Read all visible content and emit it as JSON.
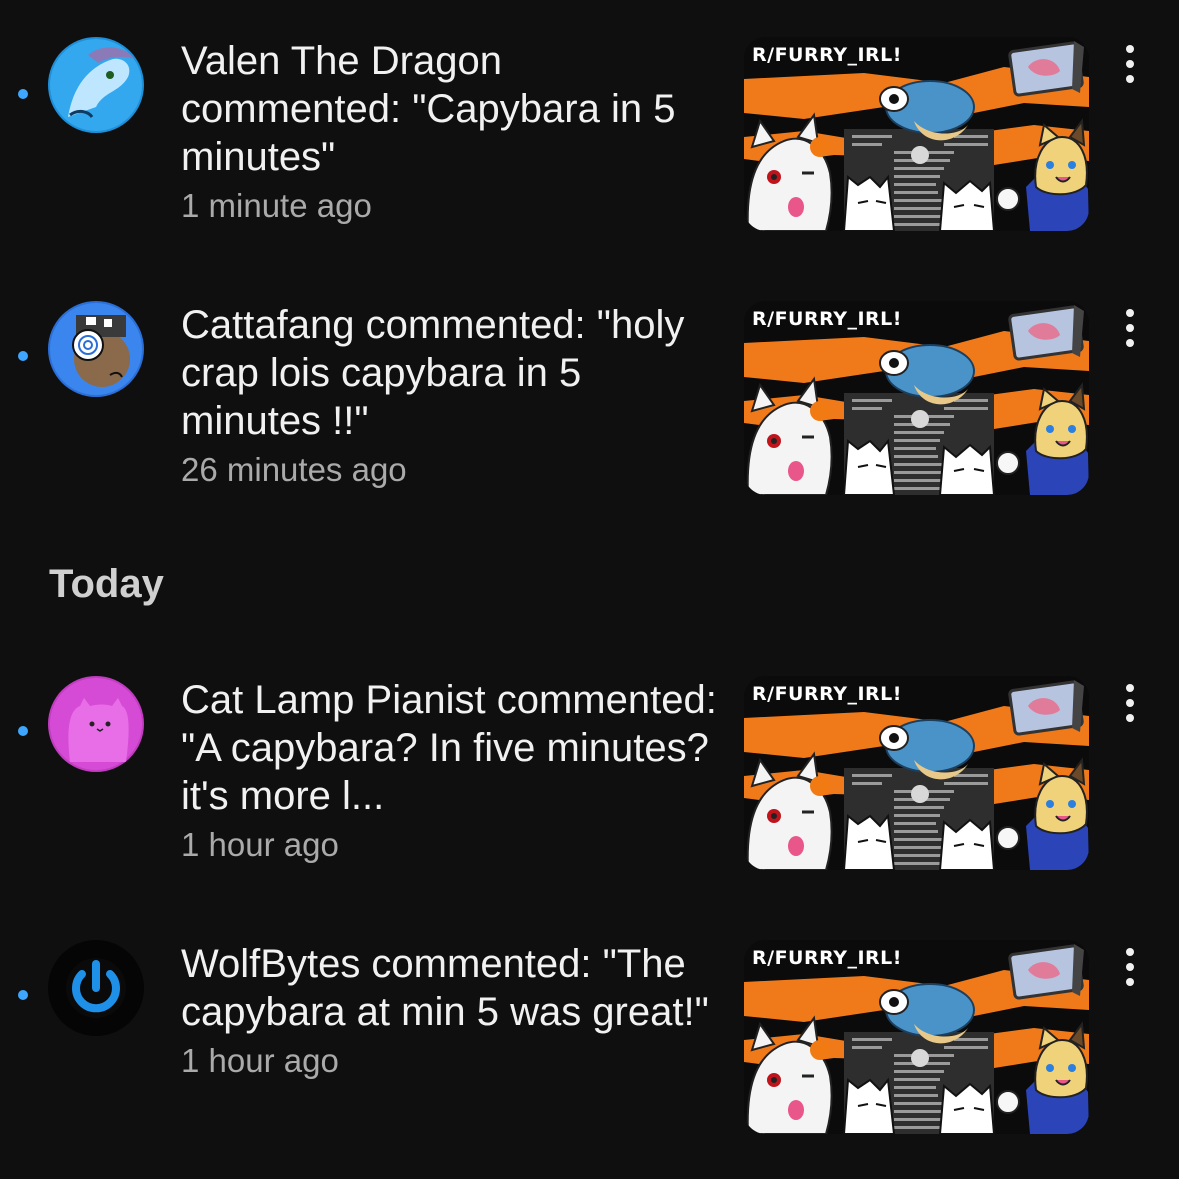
{
  "section_header": "Today",
  "notifications": [
    {
      "user": "Valen The Dragon",
      "message": "Valen The Dragon commented: \"Capybara in 5 minutes\"",
      "time": "1 minute ago",
      "thumbnail_title": "R/FURRY_IRL!",
      "unread": true
    },
    {
      "user": "Cattafang",
      "message": "Cattafang commented: \"holy crap lois capybara in 5 minutes !!\"",
      "time": "26 minutes ago",
      "thumbnail_title": "R/FURRY_IRL!",
      "unread": true
    },
    {
      "user": "Cat Lamp Pianist",
      "message": "Cat Lamp Pianist commented: \"A capybara? In five minutes? it's more l...",
      "time": "1 hour ago",
      "thumbnail_title": "R/FURRY_IRL!",
      "unread": true
    },
    {
      "user": "WolfBytes",
      "message": "WolfBytes commented: \"The capybara at min 5 was great!\"",
      "time": "1 hour ago",
      "thumbnail_title": "R/FURRY_IRL!",
      "unread": true
    }
  ],
  "colors": {
    "background": "#0f0f0f",
    "unread_dot": "#3ea6ff",
    "secondary_text": "#aaaaaa",
    "thumb_orange": "#f07a1a"
  }
}
